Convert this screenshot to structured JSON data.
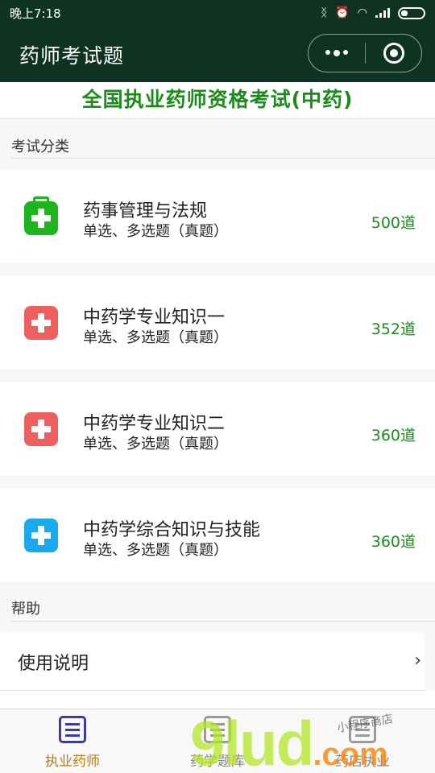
{
  "status_bar": {
    "time": "晚上7:18"
  },
  "title_bar": {
    "title": "药师考试题"
  },
  "page_header": "全国执业药师资格考试(中药)",
  "sections": {
    "exam_category": "考试分类",
    "help": "帮助"
  },
  "exam_items": [
    {
      "name": "药事管理与法规",
      "subtitle": "单选、多选题（真题）",
      "count": "500道",
      "icon": "medical-kit-icon",
      "icon_color": "#1db41d"
    },
    {
      "name": "中药学专业知识一",
      "subtitle": "单选、多选题（真题）",
      "count": "352道",
      "icon": "plus-icon",
      "icon_color": "#ee5f5f"
    },
    {
      "name": "中药学专业知识二",
      "subtitle": "单选、多选题（真题）",
      "count": "360道",
      "icon": "plus-icon",
      "icon_color": "#ee5f5f"
    },
    {
      "name": "中药学综合知识与技能",
      "subtitle": "单选、多选题（真题）",
      "count": "360道",
      "icon": "plus-icon",
      "icon_color": "#1aa8ee"
    }
  ],
  "help_items": [
    {
      "label": "使用说明"
    }
  ],
  "tab_bar": {
    "tabs": [
      {
        "label": "执业药师",
        "active": true,
        "icon": "list-icon"
      },
      {
        "label": "药学题库",
        "active": false,
        "icon": "list-icon"
      },
      {
        "label": "药店执业",
        "active": false,
        "icon": "list-icon"
      }
    ]
  },
  "watermark": {
    "brand": "9lud",
    "suffix": ".com",
    "handwriting": "小程序商店"
  },
  "colors": {
    "title_bar": "#0e3322",
    "accent_green": "#1c8b1c",
    "active_tab_label": "#c27c0e",
    "active_tab_icon": "#3b3ba0"
  }
}
